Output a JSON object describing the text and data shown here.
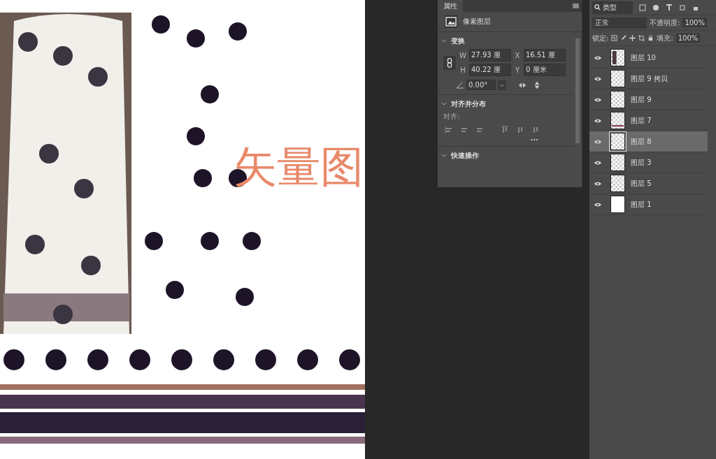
{
  "canvas": {
    "overlay_text": "矢量图"
  },
  "properties": {
    "tab": "属性",
    "layer_type": "像素图层",
    "transform": {
      "title": "变换",
      "expanded": true,
      "w_label": "W",
      "w": "27.93 厘",
      "x_label": "X",
      "x": "16.51 厘",
      "h_label": "H",
      "h": "40.22 厘",
      "y_label": "Y",
      "y": "0 厘米",
      "angle": "0.00°"
    },
    "align": {
      "title": "对齐并分布",
      "expanded": true,
      "label": "对齐:",
      "more": "..."
    },
    "quick": {
      "title": "快速操作",
      "expanded": true
    }
  },
  "layers": {
    "filter": "类型",
    "blend_mode": "正常",
    "opacity_label": "不透明度:",
    "opacity": "100%",
    "lock_label": "锁定:",
    "fill_label": "填充:",
    "fill": "100%",
    "items": [
      {
        "name": "图层 10",
        "visible": true,
        "selected": false,
        "kind": "pattern"
      },
      {
        "name": "图层 9 拷贝",
        "visible": true,
        "selected": false,
        "kind": "transparent"
      },
      {
        "name": "图层 9",
        "visible": true,
        "selected": false,
        "kind": "transparent"
      },
      {
        "name": "图层 7",
        "visible": true,
        "selected": false,
        "kind": "border"
      },
      {
        "name": "图层 8",
        "visible": true,
        "selected": true,
        "kind": "transparent"
      },
      {
        "name": "图层 3",
        "visible": true,
        "selected": false,
        "kind": "transparent"
      },
      {
        "name": "图层 5",
        "visible": true,
        "selected": false,
        "kind": "transparent"
      },
      {
        "name": "图层 1",
        "visible": true,
        "selected": false,
        "kind": "white"
      }
    ]
  }
}
